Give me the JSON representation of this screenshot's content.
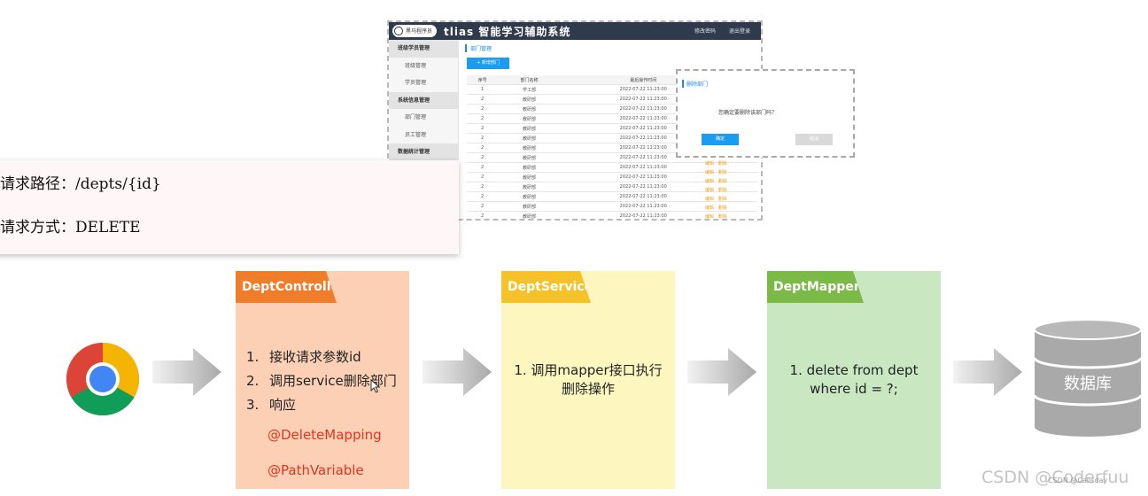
{
  "app": {
    "logo_text": "黑马程序员",
    "title": "tlias 智能学习辅助系统",
    "header_links": [
      "修改密码",
      "退出登录"
    ],
    "sidebar": [
      {
        "label": "班级学员管理",
        "group": true
      },
      {
        "label": "班级管理",
        "group": false
      },
      {
        "label": "学员管理",
        "group": false
      },
      {
        "label": "系统信息管理",
        "group": true
      },
      {
        "label": "部门管理",
        "group": false
      },
      {
        "label": "员工管理",
        "group": false
      },
      {
        "label": "数据统计管理",
        "group": true
      }
    ],
    "breadcrumb": "部门管理",
    "add_button": "+ 新增部门",
    "table": {
      "headers": [
        "序号",
        "部门名称",
        "最后操作时间",
        "操作"
      ],
      "rows": [
        [
          "1",
          "学工部",
          "2022-07-22 11:23:00"
        ],
        [
          "2",
          "教研部",
          "2022-07-22 11:23:00"
        ],
        [
          "2",
          "教研部",
          "2022-07-22 11:23:00"
        ],
        [
          "2",
          "教研部",
          "2022-07-22 11:23:00"
        ],
        [
          "2",
          "教研部",
          "2022-07-22 11:23:00"
        ],
        [
          "2",
          "教研部",
          "2022-07-22 11:23:00"
        ],
        [
          "2",
          "教研部",
          "2022-07-22 11:23:00"
        ],
        [
          "2",
          "教研部",
          "2022-07-22 11:23:00"
        ],
        [
          "2",
          "教研部",
          "2022-07-22 11:23:00"
        ],
        [
          "2",
          "教研部",
          "2022-07-22 11:23:00"
        ],
        [
          "2",
          "教研部",
          "2022-07-22 11:23:00"
        ],
        [
          "2",
          "教研部",
          "2022-07-22 11:23:00"
        ],
        [
          "2",
          "教研部",
          "2022-07-22 11:23:00"
        ],
        [
          "2",
          "教研部",
          "2022-07-22 11:23:00"
        ],
        [
          "2",
          "教研部",
          "2022-07-22 11:23:00"
        ],
        [
          "2",
          "教研部",
          "2022-07-22 11:23:00"
        ]
      ],
      "op_labels": [
        "编辑",
        "删除"
      ]
    },
    "dialog": {
      "title": "删除部门",
      "message": "您确定要删除该部门吗？",
      "confirm": "确定",
      "cancel": "取消"
    }
  },
  "request": {
    "path_line": "请求路径：/depts/{id}",
    "method_line": "请求方式：DELETE"
  },
  "flow": {
    "controller": {
      "title": "DeptController",
      "steps": [
        "1.",
        "接收请求参数id",
        "2.",
        "调用service删除部门",
        "3.",
        "响应"
      ],
      "annotations": [
        "@DeleteMapping",
        "@PathVariable"
      ]
    },
    "service": {
      "title": "DeptService",
      "line1": "1.  调用mapper接口执行",
      "line2": "删除操作"
    },
    "mapper": {
      "title": "DeptMapper",
      "line1": "1.  delete from dept",
      "line2": "where id = ?;"
    },
    "database_label": "数据库"
  },
  "watermark": {
    "main": "CSDN @Coderfuu",
    "small": "CSDN @Calisday"
  },
  "colors": {
    "controller": "#f07d2a",
    "service": "#f5c22a",
    "mapper": "#7cba47",
    "annotation": "#e0351e",
    "primary": "#1a9cf0"
  }
}
